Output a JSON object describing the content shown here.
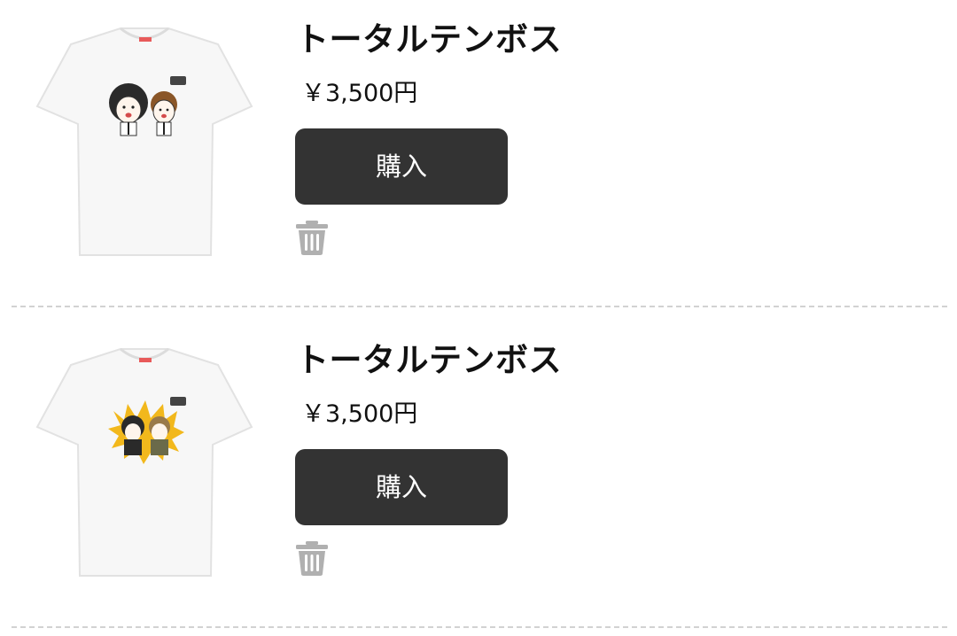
{
  "cart": {
    "items": [
      {
        "name": "トータルテンボス",
        "price": "￥3,500円",
        "buy_label": "購入",
        "image_icon": "white-tshirt-with-duo-caricature-icon",
        "delete_icon": "trash-icon"
      },
      {
        "name": "トータルテンボス",
        "price": "￥3,500円",
        "buy_label": "購入",
        "image_icon": "white-tshirt-with-yellow-burst-duo-icon",
        "delete_icon": "trash-icon"
      }
    ]
  },
  "colors": {
    "button_bg": "#333333",
    "button_text": "#ffffff",
    "trash_icon": "#b0b0b0",
    "divider": "#d2d2d2",
    "art_burst": "#f2b81c"
  }
}
